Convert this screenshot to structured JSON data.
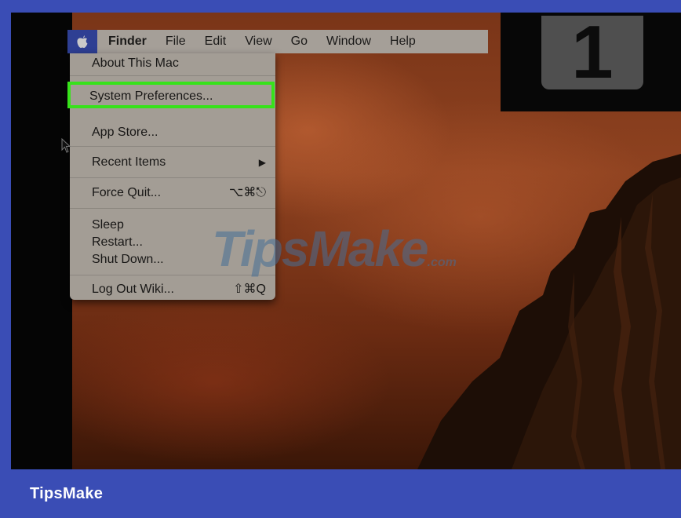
{
  "menubar": {
    "items": [
      "Finder",
      "File",
      "Edit",
      "View",
      "Go",
      "Window",
      "Help"
    ]
  },
  "apple_menu": {
    "about": "About This Mac",
    "system_preferences": "System Preferences...",
    "app_store": "App Store...",
    "recent_items": "Recent Items",
    "recent_items_arrow": "▶",
    "force_quit": "Force Quit...",
    "force_quit_shortcut": "⌥⌘⎋",
    "sleep": "Sleep",
    "restart": "Restart...",
    "shut_down": "Shut Down...",
    "log_out": "Log Out Wiki...",
    "log_out_shortcut": "⇧⌘Q"
  },
  "step": {
    "number": "1"
  },
  "watermark": {
    "text": "TipsMake",
    "suffix": ".com"
  },
  "footer": {
    "brand": "TipsMake"
  },
  "colors": {
    "frame": "#3a4db5",
    "highlight": "#37e21b",
    "menu_bg": "#a39d95",
    "apple_cell": "#2e3f93"
  },
  "icons": {
    "apple": "apple-logo-icon",
    "cursor": "mouse-pointer-icon"
  }
}
